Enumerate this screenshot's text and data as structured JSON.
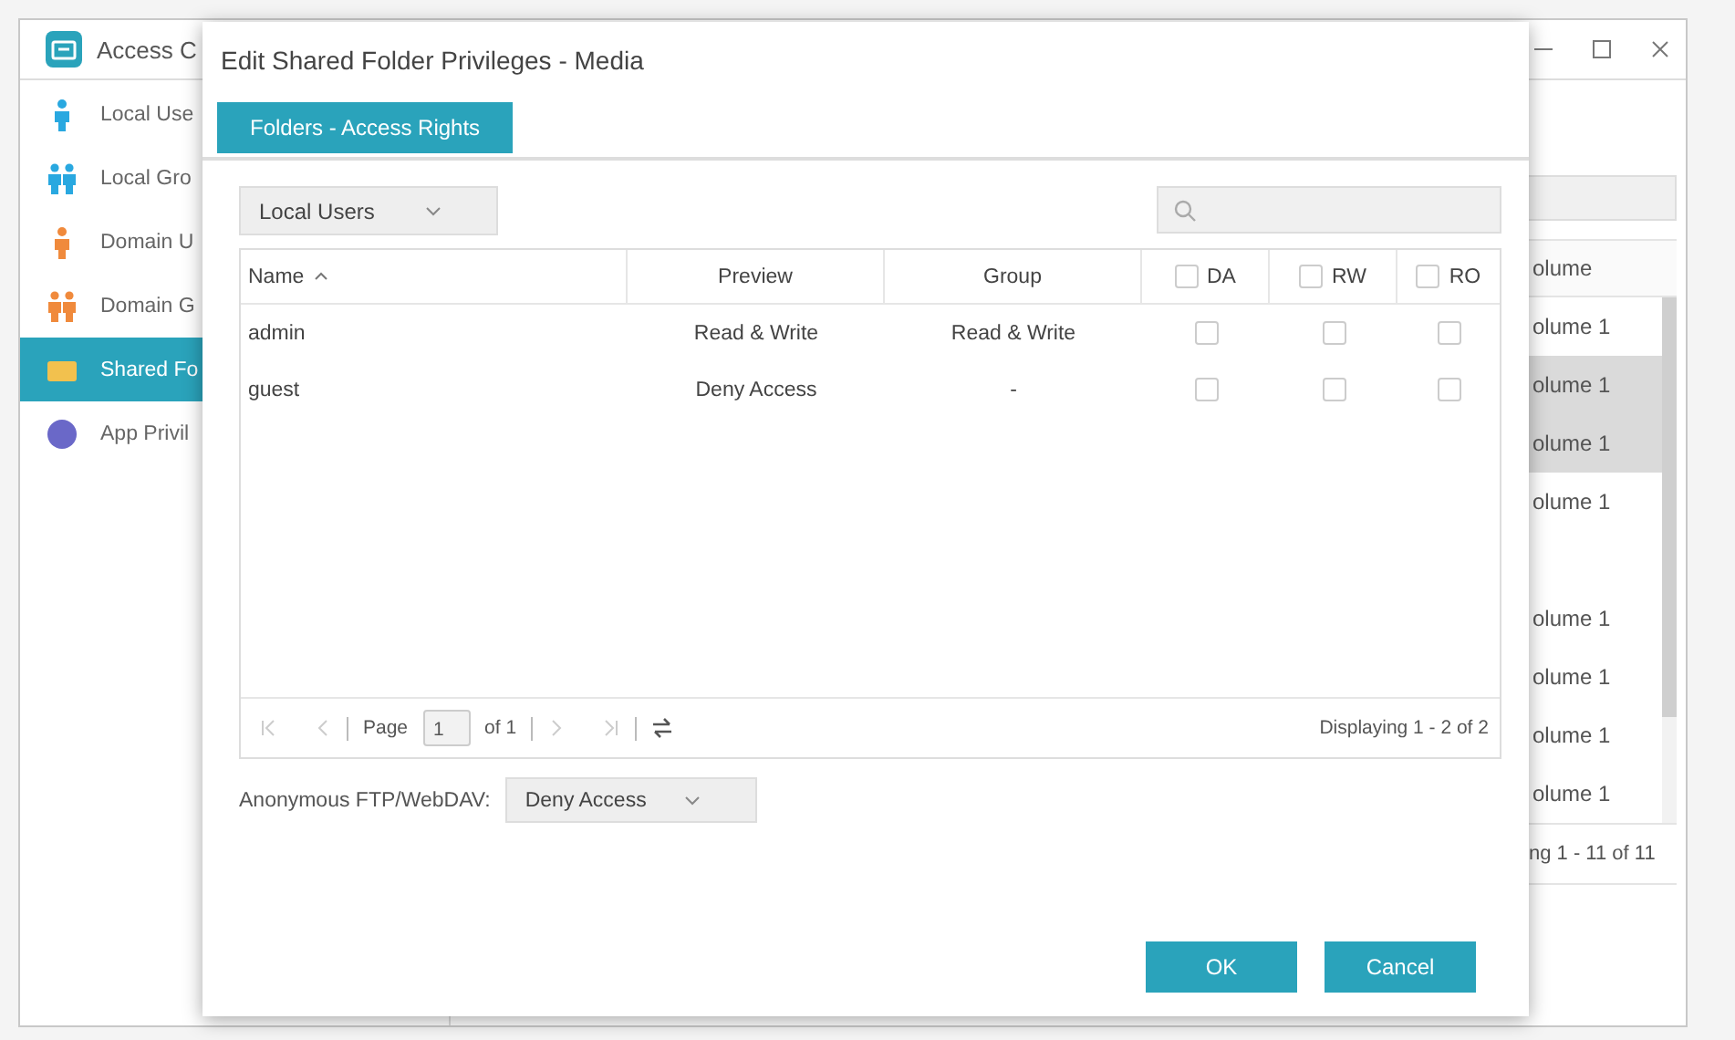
{
  "app": {
    "title": "Access C"
  },
  "sidebar": {
    "items": [
      {
        "label": "Local Use",
        "kind": "user",
        "color": "#29a8e0",
        "selected": false
      },
      {
        "label": "Local Gro",
        "kind": "group",
        "color": "#29a8e0",
        "selected": false
      },
      {
        "label": "Domain U",
        "kind": "user",
        "color": "#f08a3c",
        "selected": false
      },
      {
        "label": "Domain G",
        "kind": "group",
        "color": "#f08a3c",
        "selected": false
      },
      {
        "label": "Shared Fo",
        "kind": "folder",
        "color": "#f2c14e",
        "selected": true
      },
      {
        "label": "App Privil",
        "kind": "app",
        "color": "#6a68c8",
        "selected": false
      }
    ]
  },
  "background_table": {
    "header": "olume",
    "rows": [
      {
        "text": "olume 1",
        "selected": false
      },
      {
        "text": "olume 1",
        "selected": true
      },
      {
        "text": "olume 1",
        "selected": true
      },
      {
        "text": "olume 1",
        "selected": false
      },
      {
        "selected": false
      },
      {
        "text": "olume 1",
        "selected": false
      },
      {
        "text": "olume 1",
        "selected": false
      },
      {
        "text": "olume 1",
        "selected": false
      },
      {
        "text": "olume 1",
        "selected": false
      }
    ],
    "footer": "ng 1 - 11 of 11"
  },
  "dialog": {
    "title": "Edit Shared Folder Privileges - Media",
    "tabs": [
      {
        "label": "Folders - Access Rights",
        "selected": true
      }
    ],
    "user_filter": {
      "value": "Local Users"
    },
    "columns": [
      {
        "label": "Name",
        "kind": "text",
        "sorted": true
      },
      {
        "label": "Preview",
        "kind": "text"
      },
      {
        "label": "Group",
        "kind": "text"
      },
      {
        "label": "DA",
        "kind": "check",
        "checked": false
      },
      {
        "label": "RW",
        "kind": "check",
        "checked": false
      },
      {
        "label": "RO",
        "kind": "check",
        "checked": false
      }
    ],
    "rows": [
      {
        "name": "admin",
        "preview": "Read & Write",
        "group": "Read & Write",
        "da": false,
        "rw": false,
        "ro": false
      },
      {
        "name": "guest",
        "preview": "Deny Access",
        "group": "-",
        "da": false,
        "rw": false,
        "ro": false
      }
    ],
    "pager": {
      "page_label": "Page",
      "page": "1",
      "of": "of 1",
      "displaying": "Displaying 1 - 2 of 2"
    },
    "anonymous": {
      "label": "Anonymous FTP/WebDAV:",
      "value": "Deny Access"
    },
    "buttons": [
      "OK",
      "Cancel"
    ]
  }
}
